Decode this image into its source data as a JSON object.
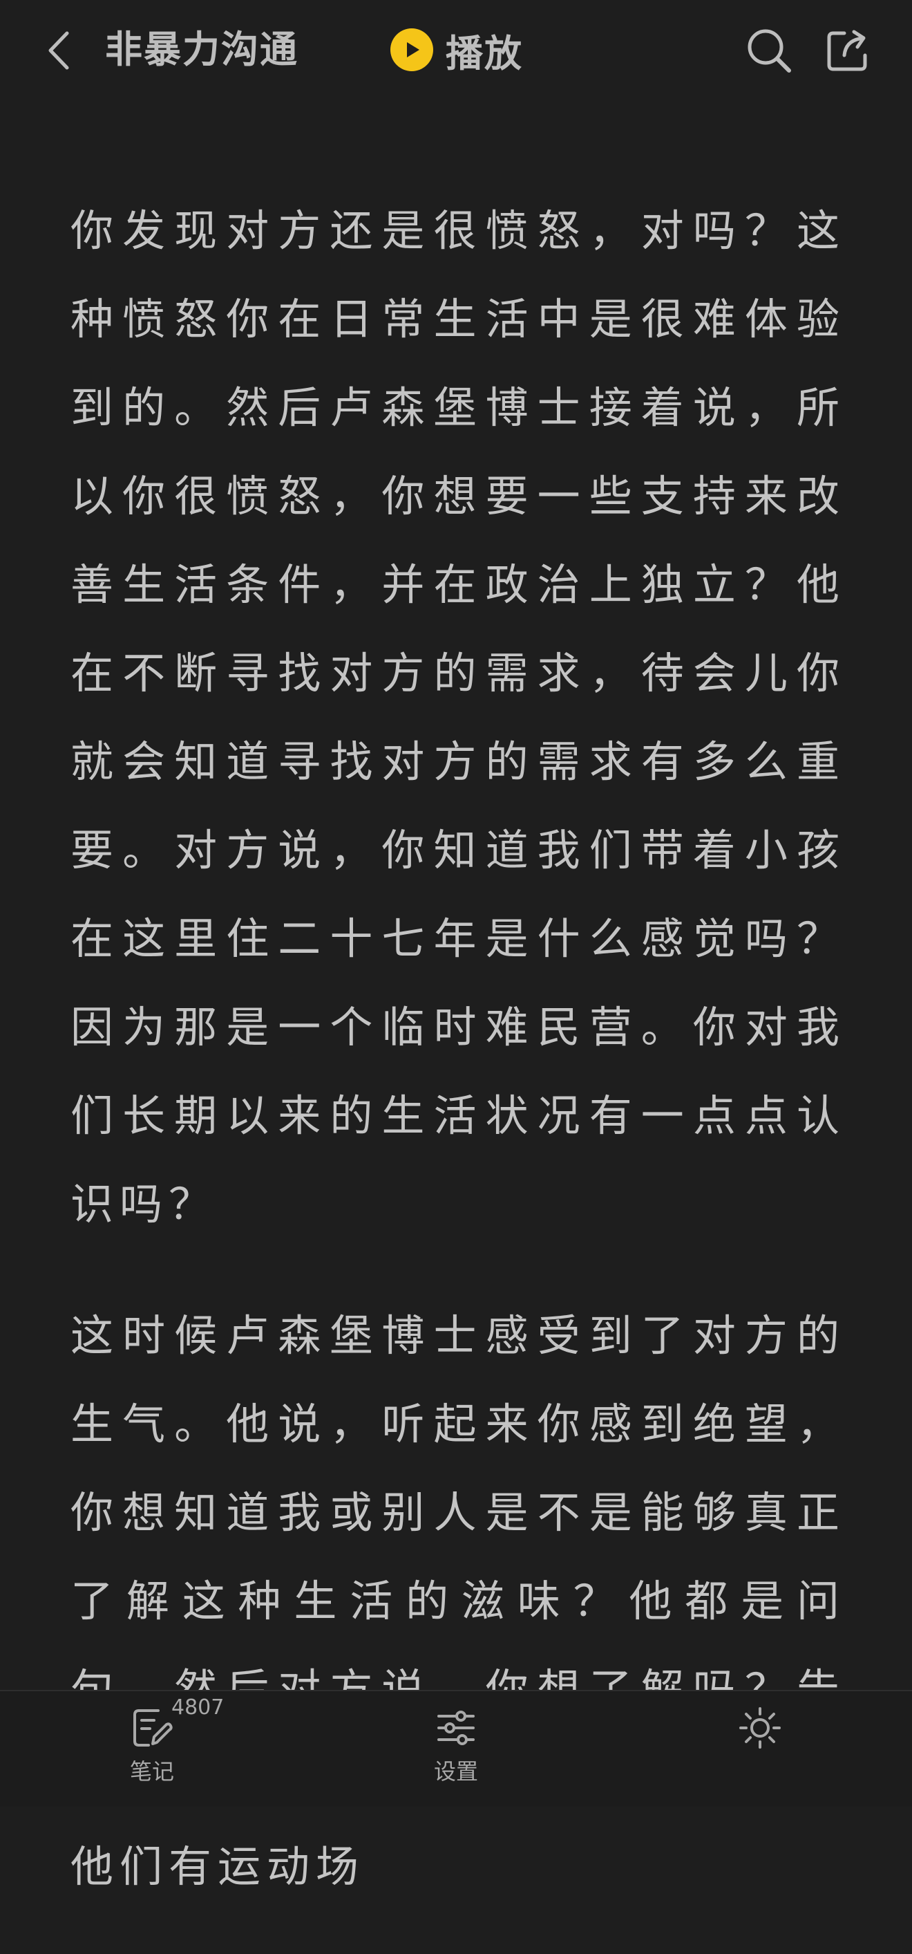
{
  "topbar": {
    "back_icon": "chevron-left-icon",
    "title": "非暴力沟通",
    "play_label": "播放",
    "play_icon": "play-icon",
    "search_icon": "search-icon",
    "share_icon": "share-icon",
    "accent_color": "#f5c518"
  },
  "content": {
    "paragraphs": [
      "你发现对方还是很愤怒，对吗？这种愤怒你在日常生活中是很难体验到的。然后卢森堡博士接着说，所以你很愤怒，你想要一些支持来改善生活条件，并在政治上独立？他在不断寻找对方的需求，待会儿你就会知道寻找对方的需求有多么重要。对方说，你知道我们带着小孩在这里住二十七年是什么感觉吗？因为那是一个临时难民营。你对我们长期以来的生活状况有一点点认识吗？",
      "这时候卢森堡博士感受到了对方的生气。他说，听起来你感到绝望，你想知道我或别人是不是能够真正了解这种生活的滋味？他都是问句。然后对方说，你想了解吗？告诉我，你有孩子吗？他们上学吗？他们有运动场"
    ]
  },
  "bottom_bar": {
    "notes_label": "笔记",
    "notes_count": "4807",
    "notes_icon": "note-edit-icon",
    "settings_label": "设置",
    "settings_icon": "sliders-icon",
    "brightness_icon": "sun-icon"
  }
}
